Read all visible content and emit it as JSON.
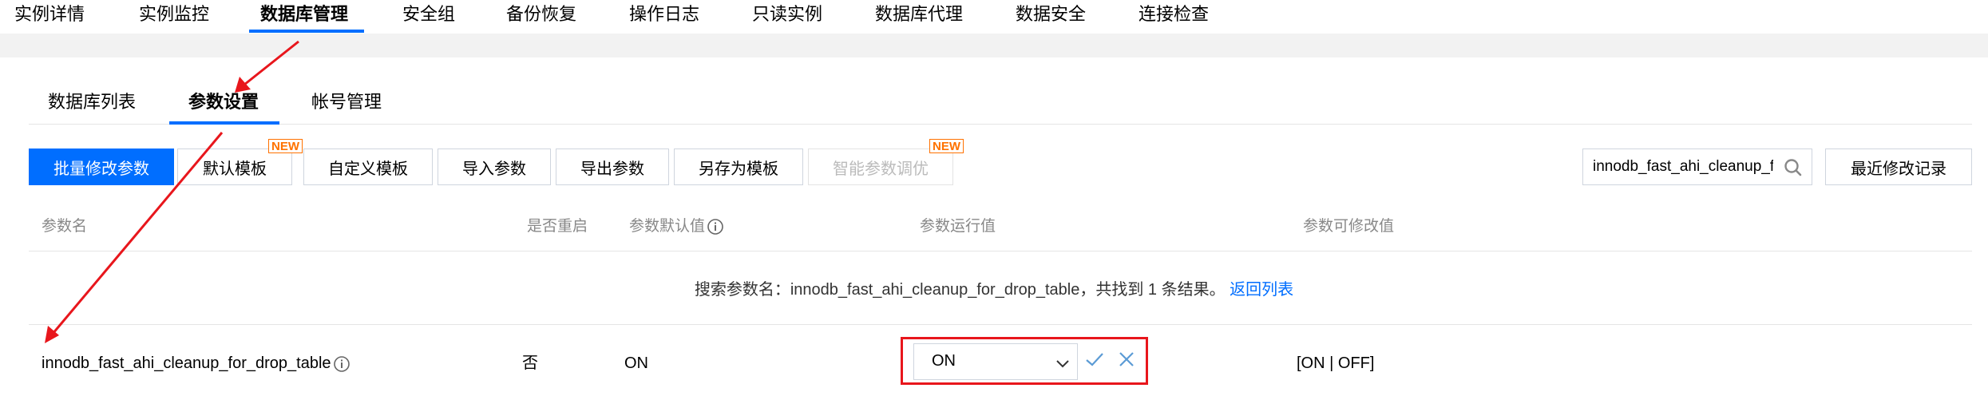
{
  "topnav": {
    "items": [
      "实例详情",
      "实例监控",
      "数据库管理",
      "安全组",
      "备份恢复",
      "操作日志",
      "只读实例",
      "数据库代理",
      "数据安全",
      "连接检查"
    ],
    "active": "数据库管理"
  },
  "subtabs": {
    "items": [
      "数据库列表",
      "参数设置",
      "帐号管理"
    ],
    "active": "参数设置"
  },
  "toolbar": {
    "batch_modify": "批量修改参数",
    "default_template": "默认模板",
    "custom_template": "自定义模板",
    "import_params": "导入参数",
    "export_params": "导出参数",
    "save_as_template": "另存为模板",
    "smart_tuning": "智能参数调优",
    "new_badge": "NEW",
    "recent_changes": "最近修改记录"
  },
  "search": {
    "value": "innodb_fast_ahi_cleanup_for_drop_table"
  },
  "table": {
    "headers": {
      "name": "参数名",
      "restart": "是否重启",
      "default": "参数默认值",
      "running": "参数运行值",
      "modifiable": "参数可修改值"
    },
    "search_result_text": "搜索参数名：innodb_fast_ahi_cleanup_for_drop_table，共找到 1 条结果。",
    "back_link": "返回列表",
    "rows": [
      {
        "name": "innodb_fast_ahi_cleanup_for_drop_table",
        "restart": "否",
        "default": "ON",
        "running": "ON",
        "modifiable": "[ON | OFF]"
      }
    ]
  },
  "colors": {
    "accent": "#006eff",
    "highlight": "#e8161c",
    "new_badge": "#ff7200"
  },
  "icons": [
    "search-icon",
    "info-icon",
    "chevron-down-icon",
    "check-icon",
    "close-icon"
  ]
}
